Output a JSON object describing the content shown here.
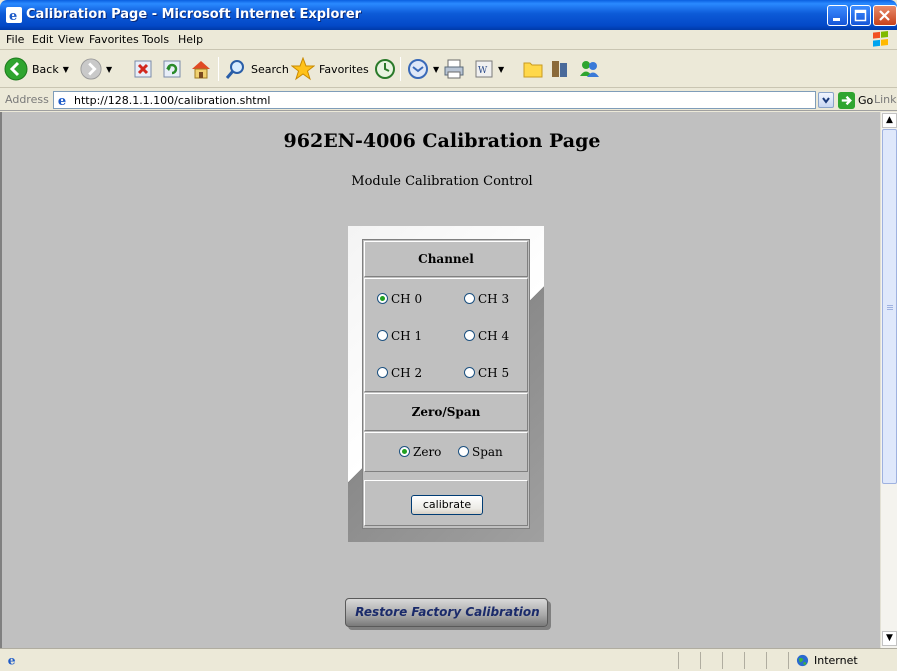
{
  "window": {
    "title": "Calibration Page - Microsoft Internet Explorer"
  },
  "menu": {
    "items": [
      {
        "label": "File"
      },
      {
        "label": "Edit"
      },
      {
        "label": "View"
      },
      {
        "label": "Favorites"
      },
      {
        "label": "Tools"
      },
      {
        "label": "Help"
      }
    ]
  },
  "toolbar": {
    "back_label": "Back",
    "search_label": "Search",
    "favorites_label": "Favorites"
  },
  "address": {
    "label": "Address",
    "url": "http://128.1.1.100/calibration.shtml",
    "go_label": "Go",
    "links_label": "Links"
  },
  "page": {
    "heading": "962EN-4006 Calibration Page",
    "subheading": "Module Calibration Control",
    "channel_header": "Channel",
    "channels": [
      {
        "label": "CH  0",
        "selected": true
      },
      {
        "label": "CH  3",
        "selected": false
      },
      {
        "label": "CH  1",
        "selected": false
      },
      {
        "label": "CH  4",
        "selected": false
      },
      {
        "label": "CH  2",
        "selected": false
      },
      {
        "label": "CH  5",
        "selected": false
      }
    ],
    "zerospan_header": "Zero/Span",
    "zero_label": "Zero",
    "span_label": "Span",
    "calibrate_label": "calibrate",
    "restore_label": "Restore Factory Calibration"
  },
  "status": {
    "zone_label": "Internet"
  },
  "colors": {
    "titlebar": "#0349c8",
    "page_bg": "#c0c0c0",
    "chrome_bg": "#ece9d8"
  }
}
